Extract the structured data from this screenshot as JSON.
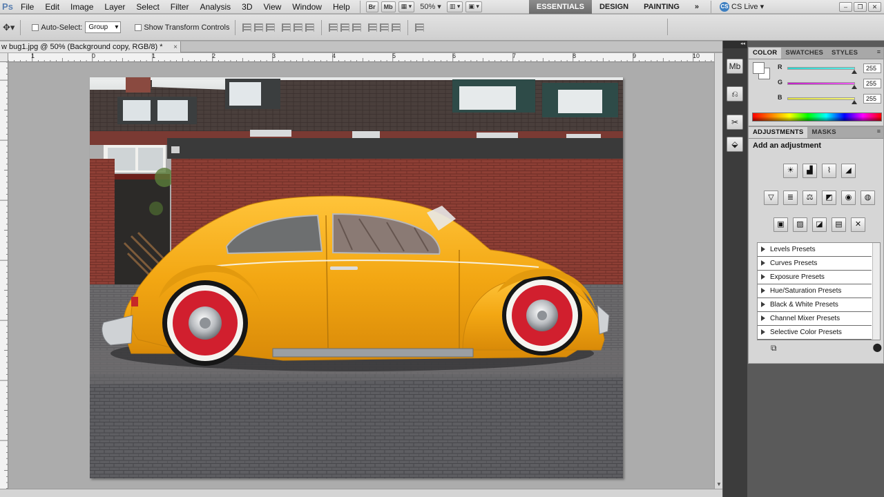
{
  "menubar": {
    "logo": "Ps",
    "items": [
      "File",
      "Edit",
      "Image",
      "Layer",
      "Select",
      "Filter",
      "Analysis",
      "3D",
      "View",
      "Window",
      "Help"
    ],
    "bridge_btn": "Br",
    "minibridge_btn": "Mb",
    "zoom": "50%",
    "workspaces": [
      "ESSENTIALS",
      "DESIGN",
      "PAINTING"
    ],
    "more": "»",
    "cslive": "CS Live",
    "cslive_logo": "CS"
  },
  "options": {
    "auto_select_label": "Auto-Select:",
    "auto_select_value": "Group",
    "transform_label": "Show Transform Controls"
  },
  "document": {
    "tab_title": "w bug1.jpg @ 50% (Background copy, RGB/8) *",
    "close": "×"
  },
  "ruler": {
    "labels": [
      "0",
      "1",
      "2",
      "3",
      "4",
      "5",
      "6",
      "7",
      "8",
      "9",
      "10"
    ]
  },
  "color_panel": {
    "tabs": [
      "COLOR",
      "SWATCHES",
      "STYLES"
    ],
    "channels": [
      {
        "label": "R",
        "value": "255",
        "color": "#3fe0d8"
      },
      {
        "label": "G",
        "value": "255",
        "color": "#d23cd6"
      },
      {
        "label": "B",
        "value": "255",
        "color": "#e8e85a"
      }
    ],
    "foreground": "#ffffff",
    "background": "#ffffff"
  },
  "adjustments_panel": {
    "tabs": [
      "ADJUSTMENTS",
      "MASKS"
    ],
    "title": "Add an adjustment",
    "presets": [
      "Levels Presets",
      "Curves Presets",
      "Exposure Presets",
      "Hue/Saturation Presets",
      "Black & White Presets",
      "Channel Mixer Presets",
      "Selective Color Presets"
    ]
  },
  "photo": {
    "car_color": "#f2a713",
    "brick_color": "#8c3d33"
  }
}
